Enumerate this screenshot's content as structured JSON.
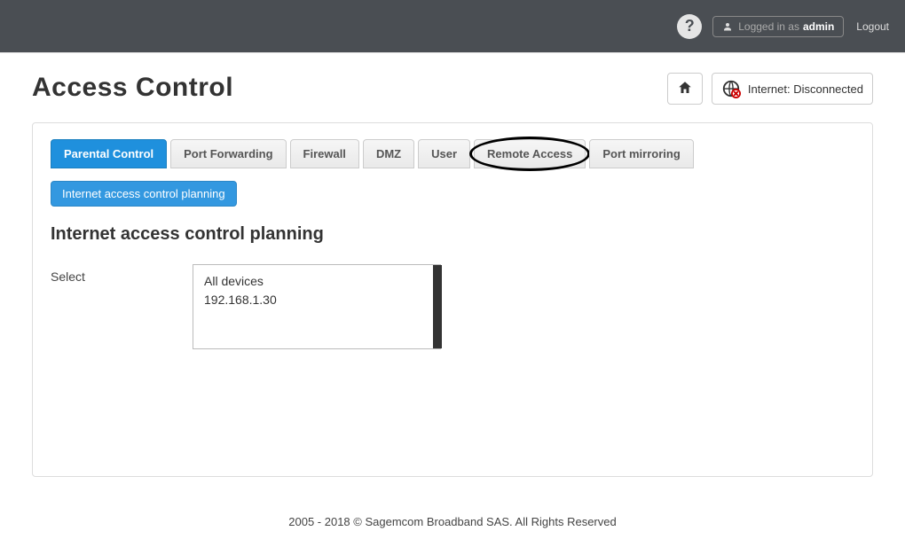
{
  "header": {
    "logged_in_text": "Logged in as",
    "username": "admin",
    "logout": "Logout"
  },
  "page": {
    "title": "Access Control",
    "internet_label": "Internet:",
    "internet_status": "Disconnected"
  },
  "tabs": [
    "Parental Control",
    "Port Forwarding",
    "Firewall",
    "DMZ",
    "User",
    "Remote Access",
    "Port mirroring"
  ],
  "subtab": "Internet access control planning",
  "section_title": "Internet access control planning",
  "form": {
    "select_label": "Select",
    "options": [
      "All devices",
      "192.168.1.30"
    ]
  },
  "footer": "2005 - 2018 © Sagemcom Broadband SAS. All Rights Reserved"
}
